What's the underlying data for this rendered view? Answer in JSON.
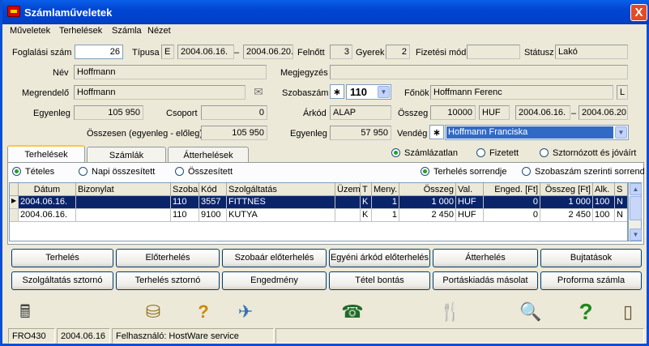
{
  "window": {
    "title": "Számlaműveletek",
    "close": "X"
  },
  "menu": [
    "Műveletek",
    "Terhelések",
    "Számla",
    "Nézet"
  ],
  "form": {
    "foglalasi_szam_label": "Foglalási szám",
    "foglalasi_szam": "26",
    "tipusa_label": "Típusa",
    "tipusa": "E",
    "date_from": "2004.06.16.",
    "dash": "–",
    "date_to": "2004.06.20.",
    "felnott_label": "Felnőtt",
    "felnott": "3",
    "gyerek_label": "Gyerek",
    "gyerek": "2",
    "fizetesi_mod_label": "Fizetési mód",
    "fizetesi_mod": "",
    "statusz_label": "Státusz",
    "statusz": "Lakó",
    "nev_label": "Név",
    "nev": "Hoffmann",
    "megjegyzes_label": "Megjegyzés",
    "megjegyzes": "",
    "megrendelo_label": "Megrendelő",
    "megrendelo": "Hoffmann",
    "szobaszam_label": "Szobaszám",
    "szobaszam_star": "∗",
    "szobaszam": "110",
    "fonok_label": "Főnök",
    "fonok": "Hoffmann Ferenc",
    "fonok_flag": "L",
    "egyenleg_label": "Egyenleg",
    "egyenleg": "105 950",
    "csoport_label": "Csoport",
    "csoport": "0",
    "arkod_label": "Árkód",
    "arkod": "ALAP",
    "osszeg_label": "Összeg",
    "osszeg": "10000",
    "penznem": "HUF",
    "ar_from": "2004.06.16.",
    "ar_to": "2004.06.20.",
    "osszesen_label": "Összesen (egyenleg - előleg)",
    "osszesen": "105 950",
    "egyenleg2_label": "Egyenleg",
    "egyenleg2": "57 950",
    "vendeg_label": "Vendég",
    "vendeg_star": "∗",
    "vendeg": "Hoffmann Franciska"
  },
  "tabs": [
    "Terhelések",
    "Számlák",
    "Átterhelések"
  ],
  "radios_top": [
    "Számlázatlan",
    "Fizetett",
    "Sztornózott és jóváírt"
  ],
  "radios_left": [
    "Tételes",
    "Napi összesített",
    "Összesített"
  ],
  "radios_right": [
    "Terhelés sorrendje",
    "Szobaszám szerinti sorrend"
  ],
  "table": {
    "headers": [
      "Dátum",
      "Bizonylat",
      "Szoba",
      "Kód",
      "Szolgáltatás",
      "Üzem",
      "T",
      "Meny.",
      "Összeg",
      "Val.",
      "Enged. [Ft]",
      "Összeg [Ft]",
      "Alk.",
      "S"
    ],
    "rows": [
      [
        "2004.06.16.",
        "",
        "110",
        "3557",
        "FITTNES",
        "",
        "K",
        "1",
        "1 000",
        "HUF",
        "0",
        "1 000",
        "100",
        "N"
      ],
      [
        "2004.06.16.",
        "",
        "110",
        "9100",
        "KUTYA",
        "",
        "K",
        "1",
        "2 450",
        "HUF",
        "0",
        "2 450",
        "100",
        "N"
      ]
    ]
  },
  "buttons_row1": [
    "Terhelés",
    "Előterhelés",
    "Szobaár előterhelés",
    "Egyéni árkód előterhelés",
    "Átterhelés",
    "Bujtatások"
  ],
  "buttons_row2": [
    "Szolgáltatás sztornó",
    "Terhelés sztornó",
    "Engedmény",
    "Tétel bontás",
    "Portáskiadás másolat",
    "Proforma számla"
  ],
  "toolbar_icons": [
    "cash-register-icon",
    "coins-icon",
    "help-head-icon",
    "airplane-icon",
    "telephone-icon",
    "cutlery-icon",
    "search-document-icon",
    "question-icon",
    "exit-door-icon"
  ],
  "status": {
    "code": "FRO430",
    "date": "2004.06.16",
    "user": "Felhasználó: HostWare service"
  }
}
